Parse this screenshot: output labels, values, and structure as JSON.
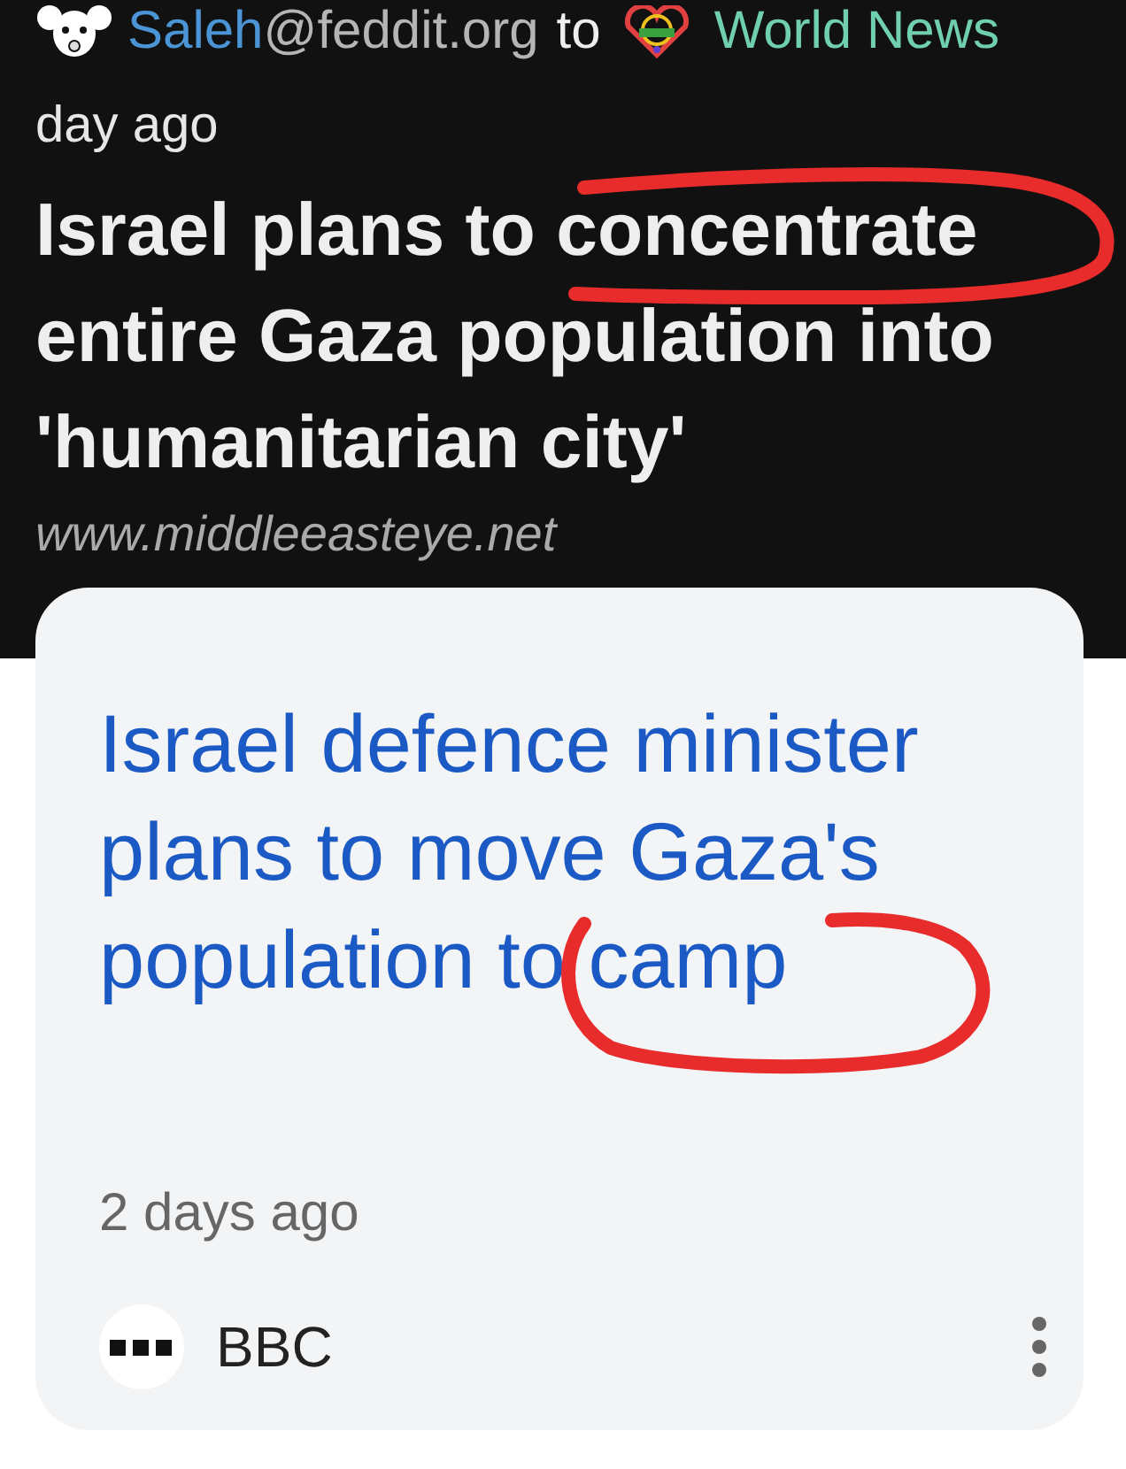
{
  "post": {
    "author": "Saleh",
    "instance": "@feddit.org",
    "connector": "to",
    "community": "World News",
    "age": "day ago",
    "title": "Israel plans to concentrate entire Gaza population into 'humanitarian city'",
    "domain": "www.middleeasteye.net"
  },
  "card": {
    "headline": "Israel defence minister plans to move Gaza's population to camp",
    "age": "2 days ago",
    "source": "BBC"
  }
}
